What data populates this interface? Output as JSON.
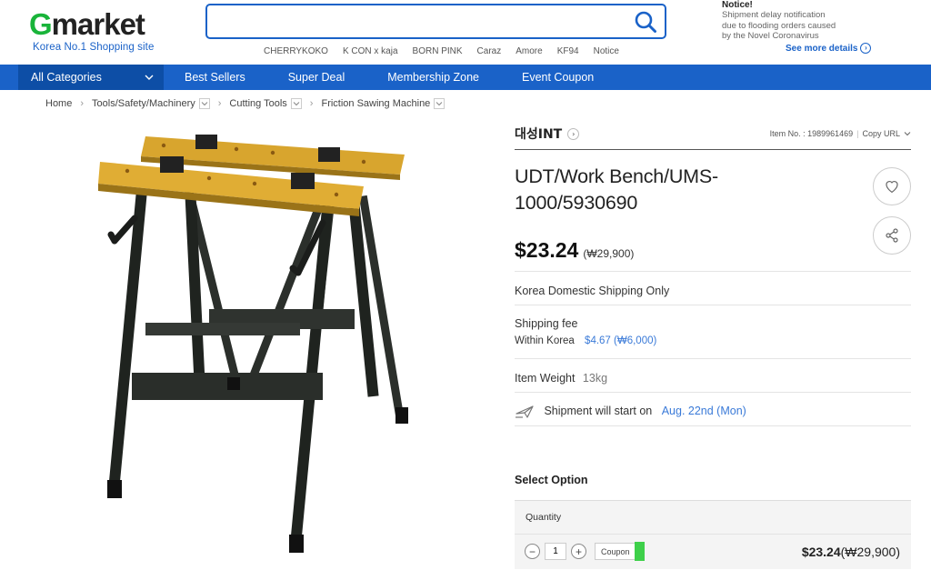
{
  "header": {
    "logo_g": "G",
    "logo_rest": "market",
    "logo_tagline": "Korea No.1 Shopping site",
    "search": {
      "value": "",
      "placeholder": ""
    },
    "keywords": [
      "CHERRYKOKO",
      "K CON x kaja",
      "BORN PINK",
      "Caraz",
      "Amore",
      "KF94",
      "Notice"
    ],
    "notice": {
      "title": "Notice!",
      "lines": [
        "Shipment delay notification",
        "due to flooding orders caused",
        "by the Novel Coronavirus"
      ],
      "more_label": "See more details"
    }
  },
  "nav": {
    "all_categories": "All Categories",
    "items": [
      "Best Sellers",
      "Super Deal",
      "Membership Zone",
      "Event Coupon"
    ]
  },
  "breadcrumb": [
    "Home",
    "Tools/Safety/Machinery",
    "Cutting Tools",
    "Friction Sawing Machine"
  ],
  "product": {
    "seller": "대성INT",
    "item_no_label": "Item No. : 1989961469",
    "copy_url_label": "Copy URL",
    "title": "UDT/Work Bench/UMS-1000/5930690",
    "price": "$23.24",
    "price_krw": "(₩29,900)",
    "domestic_shipping": "Korea Domestic Shipping Only",
    "shipping_fee_label": "Shipping fee",
    "shipping_region": "Within Korea",
    "shipping_fee_value": "$4.67 (₩6,000)",
    "weight_label": "Item Weight",
    "weight_value": "13kg",
    "shipment_start_label": "Shipment will start on",
    "shipment_start_date": "Aug. 22nd (Mon)"
  },
  "options": {
    "select_label": "Select Option",
    "quantity_label": "Quantity",
    "quantity_value": "1",
    "coupon_label": "Coupon",
    "line_price": "$23.24",
    "line_price_krw": "(₩29,900)"
  },
  "colors": {
    "brand_blue": "#1a62c8",
    "brand_green": "#19b43a",
    "link_blue": "#3a7ad8",
    "coupon_green": "#3ed04a"
  },
  "icons": [
    "search-icon",
    "chevron-down-icon",
    "chevron-right-icon",
    "heart-icon",
    "share-icon",
    "airplane-icon",
    "minus-icon",
    "plus-icon"
  ]
}
